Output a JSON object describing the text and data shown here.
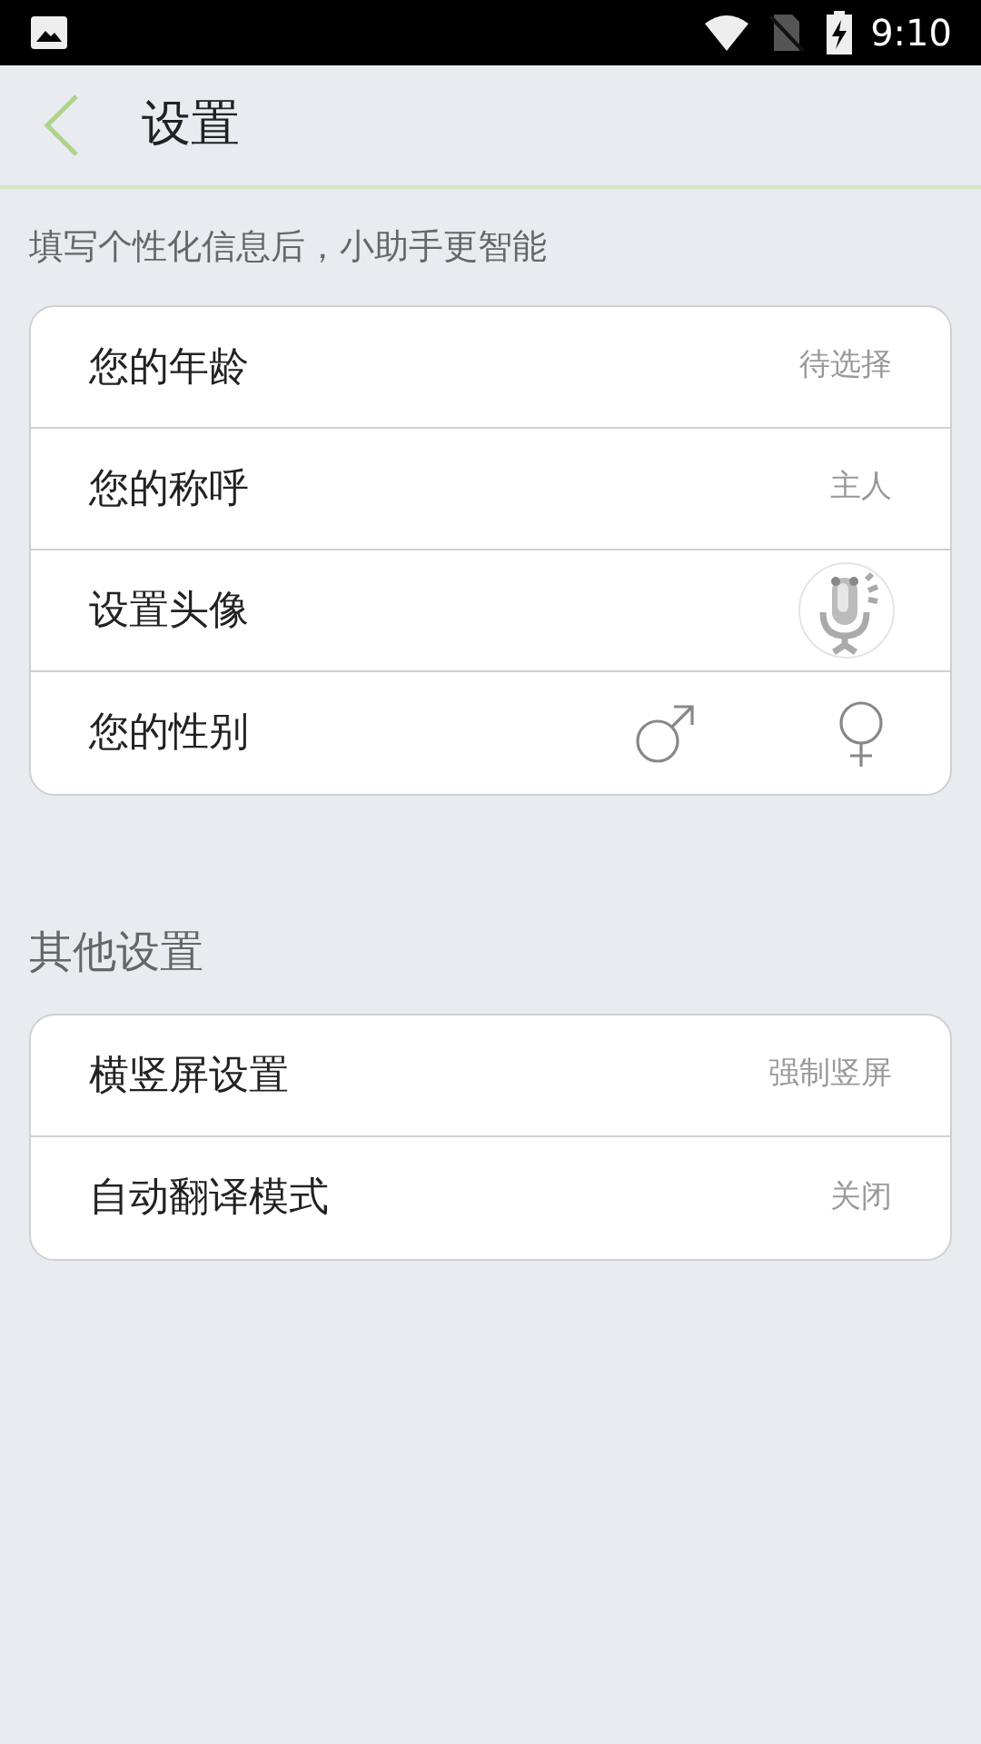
{
  "status_bar": {
    "time": "9:10"
  },
  "header": {
    "title": "设置"
  },
  "hint": "填写个性化信息后，小助手更智能",
  "profile_rows": [
    {
      "kind": "value",
      "label": "您的年龄",
      "value": "待选择"
    },
    {
      "kind": "value",
      "label": "您的称呼",
      "value": "主人"
    },
    {
      "kind": "avatar",
      "label": "设置头像"
    },
    {
      "kind": "gender",
      "label": "您的性别"
    }
  ],
  "other_title": "其他设置",
  "other_rows": [
    {
      "kind": "value",
      "label": "横竖屏设置",
      "value": "强制竖屏"
    },
    {
      "kind": "value",
      "label": "自动翻译模式",
      "value": "关闭"
    }
  ]
}
